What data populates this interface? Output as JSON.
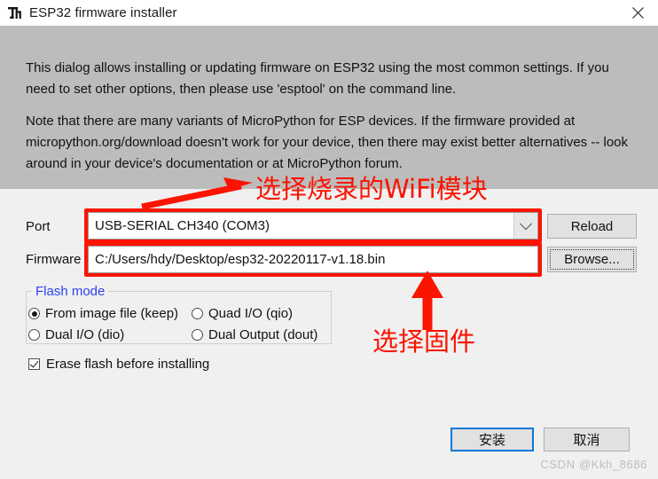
{
  "window": {
    "title": "ESP32 firmware installer",
    "icon": "thonny-logo-icon",
    "close_label": "close-icon"
  },
  "description": {
    "paragraph1": "This dialog allows installing or updating firmware on ESP32 using the most common settings. If you need to set other options, then please use 'esptool' on the command line.",
    "paragraph2": "Note that there are many variants of MicroPython for ESP devices. If the firmware provided at micropython.org/download doesn't work for your device, then there may exist better alternatives -- look around in your device's documentation or at MicroPython forum."
  },
  "form": {
    "port": {
      "label": "Port",
      "value": "USB-SERIAL CH340 (COM3)",
      "reload_label": "Reload"
    },
    "firmware": {
      "label": "Firmware",
      "value": "C:/Users/hdy/Desktop/esp32-20220117-v1.18.bin",
      "browse_label": "Browse..."
    }
  },
  "flash_mode": {
    "title": "Flash mode",
    "options": [
      {
        "label": "From image file (keep)",
        "selected": true
      },
      {
        "label": "Quad I/O (qio)",
        "selected": false
      },
      {
        "label": "Dual I/O (dio)",
        "selected": false
      },
      {
        "label": "Dual Output (dout)",
        "selected": false
      }
    ]
  },
  "erase_flash": {
    "label": "Erase flash before installing",
    "checked": true
  },
  "buttons": {
    "install": "安装",
    "cancel": "取消"
  },
  "annotations": {
    "port_note": "选择烧录的WiFi模块",
    "firmware_note": "选择固件",
    "color": "#fb1400"
  },
  "watermark": "CSDN @Kkh_8686",
  "colors": {
    "description_band": "#bcbcbc",
    "form_background": "#f0f0f0",
    "labelframe_title": "#2b43ef",
    "focus_border": "#0a7ad6",
    "annotation_red": "#fb1400"
  }
}
